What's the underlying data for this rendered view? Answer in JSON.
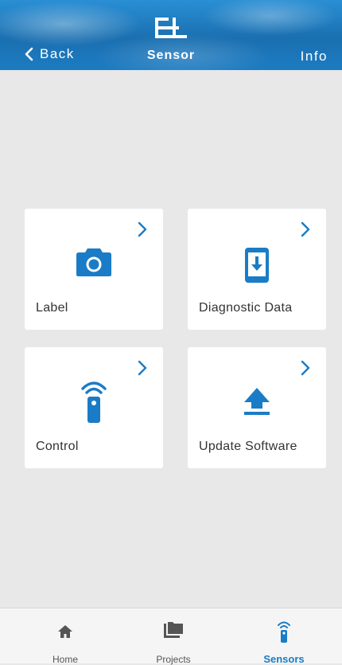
{
  "header": {
    "back_label": "Back",
    "title": "Sensor",
    "info_label": "Info"
  },
  "cards": [
    {
      "label": "Label",
      "icon": "camera-icon"
    },
    {
      "label": "Diagnostic Data",
      "icon": "phone-download-icon"
    },
    {
      "label": "Control",
      "icon": "remote-control-icon"
    },
    {
      "label": "Update Software",
      "icon": "upload-icon"
    }
  ],
  "tabs": [
    {
      "label": "Home",
      "icon": "home-icon",
      "active": false
    },
    {
      "label": "Projects",
      "icon": "folder-icon",
      "active": false
    },
    {
      "label": "Sensors",
      "icon": "sensor-icon",
      "active": true
    }
  ],
  "colors": {
    "accent": "#1a7cc6",
    "header": "#1a6fb0",
    "background": "#e8e8e8"
  }
}
